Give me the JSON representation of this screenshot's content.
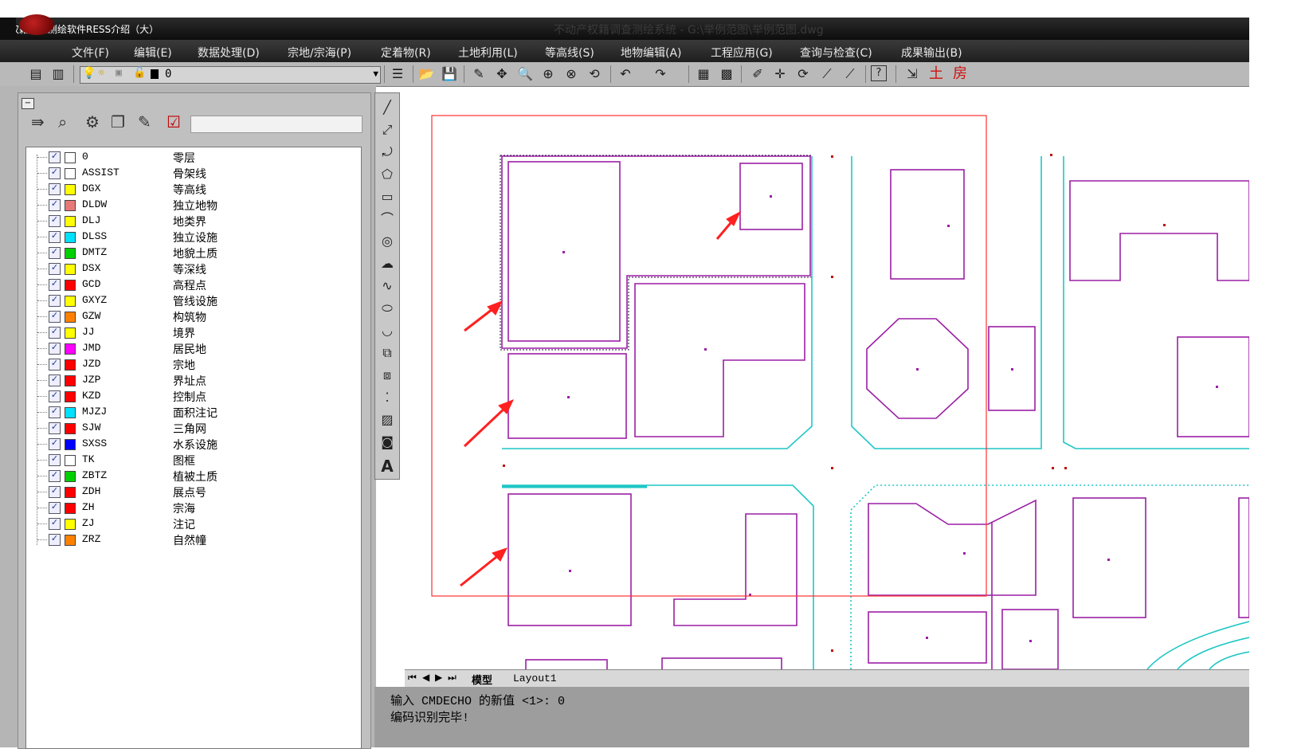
{
  "video_title": "产权籍调查测绘软件RESS介绍（大）",
  "cad_title": "不动产权籍调查测绘系统  - G:\\举例范图\\举例范图.dwg",
  "menu": [
    "文件(F)",
    "编辑(E)",
    "数据处理(D)",
    "宗地/宗海(P)",
    "定着物(R)",
    "土地利用(L)",
    "等高线(S)",
    "地物编辑(A)",
    "工程应用(G)",
    "查询与检查(C)",
    "成果输出(B)"
  ],
  "toolbar": {
    "current_layer": "0",
    "icons": [
      "layer-manager-icon",
      "layer-state-icon",
      "bulb-icon",
      "sun-icon",
      "lock-icon",
      "open-icon",
      "save-icon",
      "pencil-icon",
      "point-icon",
      "zoom-icon",
      "zoom-window-icon",
      "zoom-extents-icon",
      "zoom-previous-icon",
      "undo-icon",
      "redo-icon",
      "properties-icon",
      "table-icon",
      "draw-icon",
      "move-icon",
      "offset-icon",
      "trim-icon",
      "extend-icon",
      "help-icon",
      "export-icon"
    ],
    "tu_label": "土",
    "fang_label": "房"
  },
  "layers": [
    {
      "name": "0",
      "desc": "零层",
      "color": "#ffffff"
    },
    {
      "name": "ASSIST",
      "desc": "骨架线",
      "color": "#ffffff"
    },
    {
      "name": "DGX",
      "desc": "等高线",
      "color": "#ffff00"
    },
    {
      "name": "DLDW",
      "desc": "独立地物",
      "color": "#e87878"
    },
    {
      "name": "DLJ",
      "desc": "地类界",
      "color": "#ffff00"
    },
    {
      "name": "DLSS",
      "desc": "独立设施",
      "color": "#00e0ff"
    },
    {
      "name": "DMTZ",
      "desc": "地貌土质",
      "color": "#00d000"
    },
    {
      "name": "DSX",
      "desc": "等深线",
      "color": "#ffff00"
    },
    {
      "name": "GCD",
      "desc": "高程点",
      "color": "#ff0000"
    },
    {
      "name": "GXYZ",
      "desc": "管线设施",
      "color": "#ffff00"
    },
    {
      "name": "GZW",
      "desc": "构筑物",
      "color": "#ff8000"
    },
    {
      "name": "JJ",
      "desc": "境界",
      "color": "#ffff00"
    },
    {
      "name": "JMD",
      "desc": "居民地",
      "color": "#ff00ff"
    },
    {
      "name": "JZD",
      "desc": "宗地",
      "color": "#ff0000"
    },
    {
      "name": "JZP",
      "desc": "界址点",
      "color": "#ff0000"
    },
    {
      "name": "KZD",
      "desc": "控制点",
      "color": "#ff0000"
    },
    {
      "name": "MJZJ",
      "desc": "面积注记",
      "color": "#00e0ff"
    },
    {
      "name": "SJW",
      "desc": "三角网",
      "color": "#ff0000"
    },
    {
      "name": "SXSS",
      "desc": "水系设施",
      "color": "#0000ff"
    },
    {
      "name": "TK",
      "desc": "图框",
      "color": "#ffffff"
    },
    {
      "name": "ZBTZ",
      "desc": "植被土质",
      "color": "#00d000"
    },
    {
      "name": "ZDH",
      "desc": "展点号",
      "color": "#ff0000"
    },
    {
      "name": "ZH",
      "desc": "宗海",
      "color": "#ff0000"
    },
    {
      "name": "ZJ",
      "desc": "注记",
      "color": "#ffff00"
    },
    {
      "name": "ZRZ",
      "desc": "自然幢",
      "color": "#ff8000"
    }
  ],
  "tabs": {
    "model": "模型",
    "layout1": "Layout1"
  },
  "command": {
    "line1": "输入 CMDECHO 的新值 <1>: 0",
    "line2": "编码识别完毕!"
  },
  "colors": {
    "building": "#9b1fa5",
    "road": "#1fc6c6",
    "highlight": "#ff3030",
    "arrow": "#ff2020"
  }
}
